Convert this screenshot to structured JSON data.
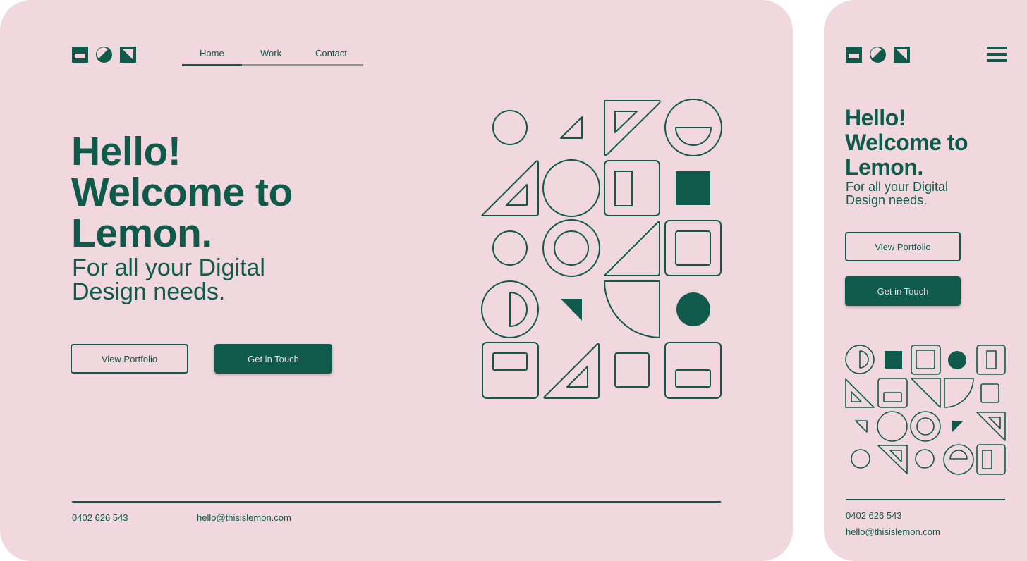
{
  "colors": {
    "background": "#f0d8de",
    "accent": "#0f5a4b",
    "nav_track": "#8b9a96"
  },
  "logo": {
    "icons": [
      "square-bar-icon",
      "half-circle-icon",
      "corner-triangle-icon"
    ]
  },
  "nav": {
    "items": [
      "Home",
      "Work",
      "Contact"
    ],
    "active": "Home"
  },
  "hero": {
    "line1": "Hello!",
    "line2": "Welcome to",
    "line3": "Lemon.",
    "sub1": "For all your Digital",
    "sub2": "Design needs."
  },
  "buttons": {
    "portfolio": "View Portfolio",
    "contact": "Get in Touch"
  },
  "footer": {
    "phone": "0402 626 543",
    "email": "hello@thisislemon.com"
  },
  "mobile": {
    "menu_icon": "hamburger-menu-icon"
  }
}
